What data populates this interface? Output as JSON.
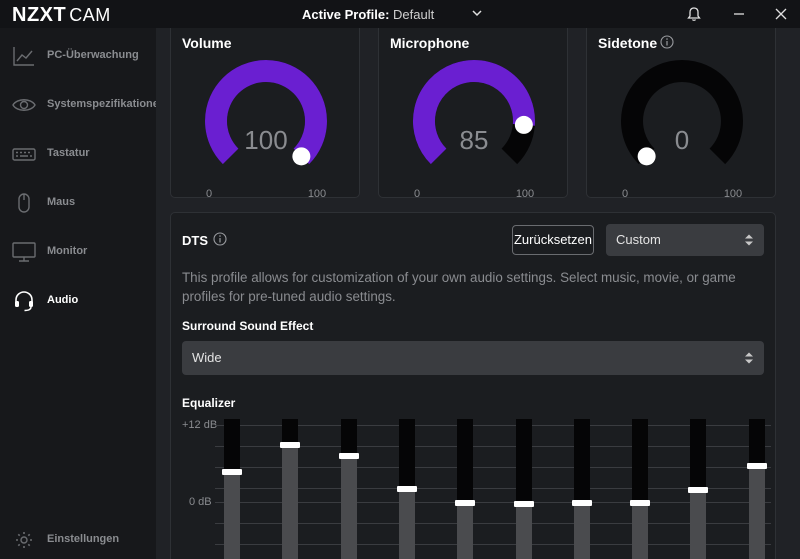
{
  "app": {
    "brand": "NZXT",
    "product": "CAM"
  },
  "header": {
    "profile_label": "Active Profile:",
    "profile_value": "Default"
  },
  "sidebar": {
    "items": [
      {
        "label": "PC-Überwachung",
        "icon": "chart-icon"
      },
      {
        "label": "Systemspezifikationen",
        "icon": "eye-icon"
      },
      {
        "label": "Tastatur",
        "icon": "keyboard-icon"
      },
      {
        "label": "Maus",
        "icon": "mouse-icon"
      },
      {
        "label": "Monitor",
        "icon": "monitor-icon"
      },
      {
        "label": "Audio",
        "icon": "headset-icon",
        "active": true
      }
    ],
    "settings_label": "Einstellungen"
  },
  "gauges": [
    {
      "title": "Volume",
      "value": "100",
      "min": "0",
      "max": "100",
      "fraction": 1.0,
      "color": "#6a1fd1"
    },
    {
      "title": "Microphone",
      "value": "85",
      "min": "0",
      "max": "100",
      "fraction": 0.85,
      "color": "#6a1fd1"
    },
    {
      "title": "Sidetone",
      "value": "0",
      "min": "0",
      "max": "100",
      "fraction": 0.0,
      "color": "#6a1fd1"
    }
  ],
  "dts": {
    "title": "DTS",
    "reset_label": "Zurücksetzen",
    "preset_value": "Custom",
    "description": "This profile allows for customization of your own audio settings. Select music, movie, or game profiles for pre-tuned audio settings.",
    "surround_title": "Surround Sound Effect",
    "surround_value": "Wide",
    "equalizer_title": "Equalizer",
    "eq_top_label": "+12 dB",
    "eq_mid_label": "0 dB",
    "eq_bands_db": [
      4.7,
      8.9,
      7.1,
      2.0,
      -0.2,
      -0.3,
      -0.1,
      -0.2,
      1.8,
      5.6
    ]
  }
}
